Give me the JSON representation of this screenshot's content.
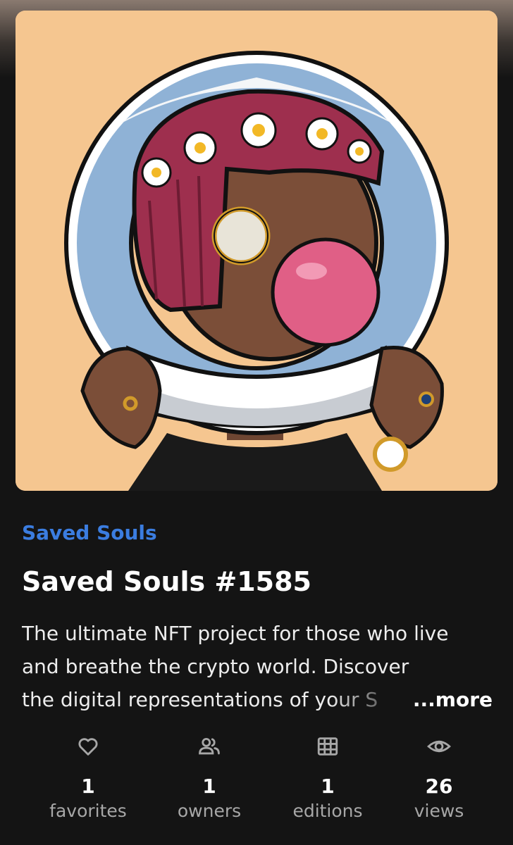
{
  "nft": {
    "collection": "Saved Souls",
    "title": "Saved Souls #1585",
    "description": {
      "line1": "The ultimate NFT project for those who live",
      "line2": "and breathe the crypto world. Discover",
      "line3": "the digital representations of your S",
      "more_label": "...more"
    }
  },
  "stats": [
    {
      "icon": "heart-icon",
      "value": "1",
      "label": "favorites"
    },
    {
      "icon": "people-icon",
      "value": "1",
      "label": "owners"
    },
    {
      "icon": "grid-icon",
      "value": "1",
      "label": "editions"
    },
    {
      "icon": "eye-icon",
      "value": "26",
      "label": "views"
    }
  ],
  "colors": {
    "background": "#141414",
    "collection_link": "#3b7de0",
    "art_background": "#f5c690",
    "muted_text": "#a7a7a7"
  }
}
